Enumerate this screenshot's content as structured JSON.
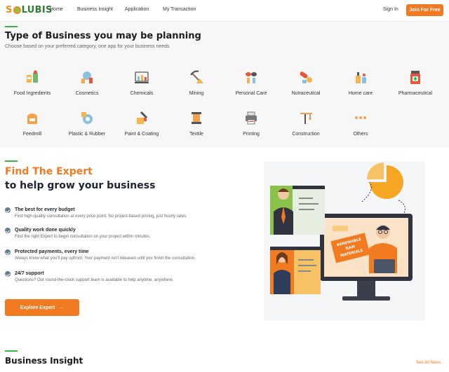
{
  "nav": {
    "logo_s": "S",
    "logo_rest": "LUBIS",
    "links": [
      "Home",
      "Business Insight",
      "Application",
      "My Transaction"
    ],
    "sign_in": "Sign In",
    "join": "Join For Free"
  },
  "business_types": {
    "title": "Type of Business you may be planning",
    "subtitle": "Choose based on your preferred category, one app for your business needs",
    "categories": [
      {
        "label": "Food Ingredients",
        "icon": "food-ingredients-icon"
      },
      {
        "label": "Cosmetics",
        "icon": "cosmetics-icon"
      },
      {
        "label": "Chemicals",
        "icon": "chemicals-icon"
      },
      {
        "label": "Mining",
        "icon": "mining-icon"
      },
      {
        "label": "Personal Care",
        "icon": "personal-care-icon"
      },
      {
        "label": "Nutraceutical",
        "icon": "nutraceutical-icon"
      },
      {
        "label": "Home care",
        "icon": "home-care-icon"
      },
      {
        "label": "Pharmaceutical",
        "icon": "pharmaceutical-icon"
      },
      {
        "label": "Feedmill",
        "icon": "feedmill-icon"
      },
      {
        "label": "Plastic & Rubber",
        "icon": "plastic-rubber-icon"
      },
      {
        "label": "Paint & Coating",
        "icon": "paint-coating-icon"
      },
      {
        "label": "Textile",
        "icon": "textile-icon"
      },
      {
        "label": "Printing",
        "icon": "printing-icon"
      },
      {
        "label": "Construction",
        "icon": "construction-icon"
      },
      {
        "label": "Others",
        "icon": "more-dots-icon"
      }
    ]
  },
  "expert": {
    "title_orange": "Find The Expert",
    "title_dark": "to help grow your business",
    "features": [
      {
        "title": "The best for every budget",
        "desc": "Find high-quality consultation at every price point. No project-based pricing, just hourly rates."
      },
      {
        "title": "Quality work done quickly",
        "desc": "Find the right Expert to begin consultation on your project within minutes."
      },
      {
        "title": "Protected payments, every time",
        "desc": "Always know what you'll pay upfront. Your payment isn't released until you finish the consultation."
      },
      {
        "title": "24/7 support",
        "desc": "Questions? Our round-the-clock support team is available to help anytime, anywhere."
      }
    ],
    "button": "Explore Expert",
    "illustration_text": [
      "RENEWABLE",
      "RAW",
      "MATERIALS"
    ],
    "colors": {
      "accent": "#f27a20",
      "green": "#3bb54a"
    }
  },
  "insight": {
    "title": "Business Insight",
    "see_all": "See All News"
  }
}
